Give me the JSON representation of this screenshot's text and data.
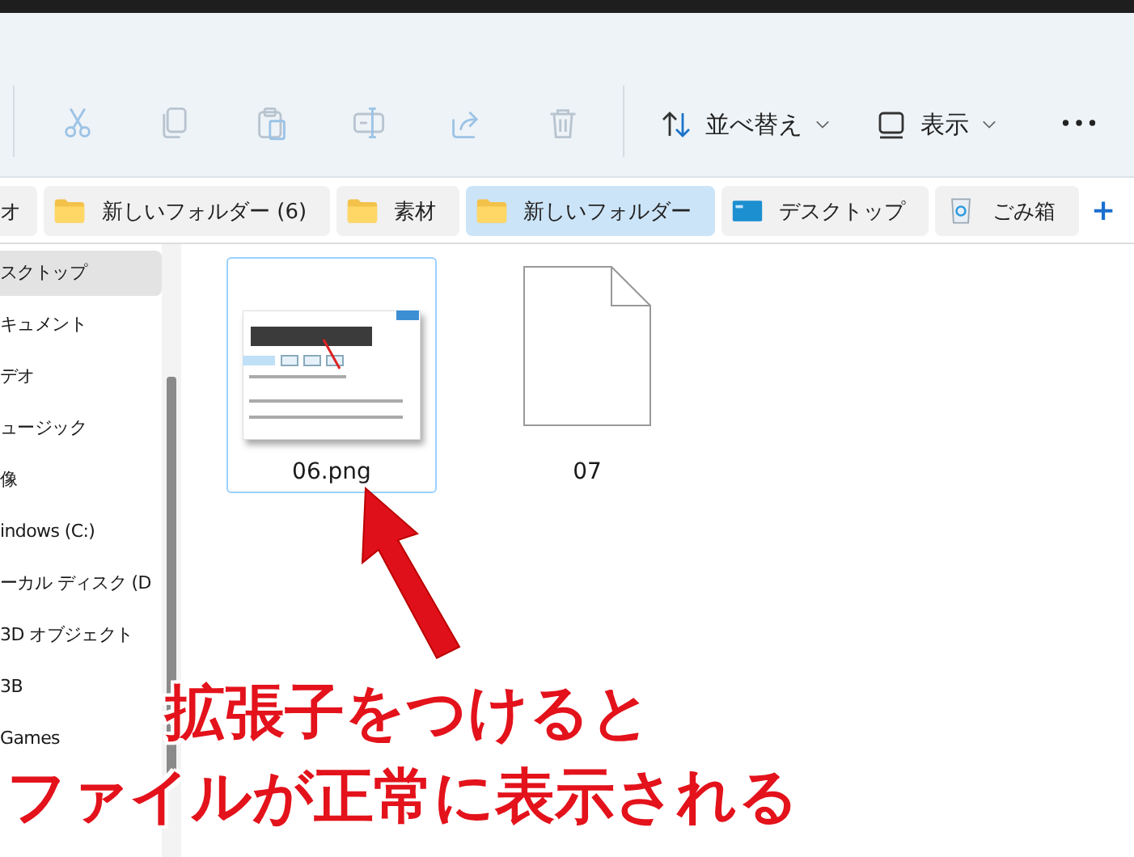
{
  "toolbar": {
    "sort_button": "並べ替え",
    "view_button": "表示"
  },
  "bookmarks": [
    {
      "label": "オ",
      "kind": "plain",
      "selected": false
    },
    {
      "label": "新しいフォルダー (6)",
      "kind": "folder",
      "selected": false
    },
    {
      "label": "素材",
      "kind": "folder",
      "selected": false
    },
    {
      "label": "新しいフォルダー",
      "kind": "folder",
      "selected": true
    },
    {
      "label": "デスクトップ",
      "kind": "desktop",
      "selected": false
    },
    {
      "label": "ごみ箱",
      "kind": "trash",
      "selected": false
    }
  ],
  "add_bookmark": "+",
  "sidebar": {
    "items": [
      {
        "label": "スクトップ",
        "selected": true
      },
      {
        "label": "キュメント",
        "selected": false
      },
      {
        "label": "デオ",
        "selected": false
      },
      {
        "label": "ュージック",
        "selected": false
      },
      {
        "label": "像",
        "selected": false
      },
      {
        "label": "indows (C:)",
        "selected": false
      },
      {
        "label": "ーカル ディスク (D",
        "selected": false
      },
      {
        "label": "3D オブジェクト",
        "selected": false
      },
      {
        "label": "3B",
        "selected": false
      },
      {
        "label": "Games",
        "selected": false
      }
    ]
  },
  "files": [
    {
      "name": "06.png",
      "kind": "image",
      "selected": true
    },
    {
      "name": "07",
      "kind": "blank",
      "selected": false
    }
  ],
  "caption": [
    "拡張子をつけると",
    "ファイルが正常に表示される"
  ]
}
